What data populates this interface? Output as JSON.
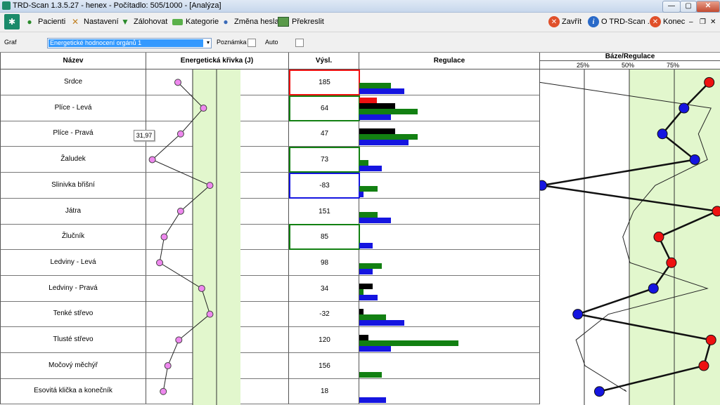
{
  "window": {
    "title": "TRD-Scan 1.3.5.27  -  henex  -  Počítadlo: 505/1000  -  [Analýza]",
    "minimize": "—",
    "maximize": "▢",
    "close": "✕"
  },
  "toolbar": {
    "pacienti": "Pacienti",
    "nastaveni": "Nastavení",
    "zalohovat": "Zálohovat",
    "kategorie": "Kategorie",
    "zmena_hesla": "Změna hesla",
    "prekreslit": "Překreslit",
    "zavrit": "Zavřít",
    "o_trd": "O TRD-Scan ...",
    "konec": "Konec",
    "mdi_min": "–",
    "mdi_restore": "❐",
    "mdi_close": "✕"
  },
  "options": {
    "graf_label": "Graf",
    "graf_value": "Energetické hodnocení orgánů 1",
    "poznamka_label": "Poznámka",
    "auto_label": "Auto"
  },
  "headers": {
    "nazev": "Název",
    "krivka": "Energetická křivka (J)",
    "vysl": "Výsl.",
    "regulace": "Regulace",
    "baze": "Báze/Regulace",
    "ticks": [
      "25%",
      "50%",
      "75%"
    ]
  },
  "tooltip": "31,97",
  "colors": {
    "red": "#ee1111",
    "green": "#128012",
    "blue": "#1515e0",
    "black": "#000000",
    "pink": "#ee88ee",
    "zone": "#e2f7cd"
  },
  "rows": [
    {
      "name": "Srdce",
      "result": "185",
      "border": "red",
      "curve": 0.3,
      "bars": [
        {
          "c": "green",
          "v": 45
        },
        {
          "c": "blue",
          "v": 64
        }
      ],
      "dot": 0.94,
      "dotColor": "red",
      "thin": 0.0
    },
    {
      "name": "Plíce - Levá",
      "result": "64",
      "border": "green",
      "curve": 0.58,
      "bars": [
        {
          "c": "red",
          "v": 25
        },
        {
          "c": "black",
          "v": 51
        },
        {
          "c": "green",
          "v": 83
        },
        {
          "c": "blue",
          "v": 45
        }
      ],
      "dot": 0.8,
      "dotColor": "blue",
      "thin": 0.95
    },
    {
      "name": "Plíce - Pravá",
      "result": "47",
      "border": "",
      "curve": 0.33,
      "bars": [
        {
          "c": "black",
          "v": 51
        },
        {
          "c": "green",
          "v": 83
        },
        {
          "c": "blue",
          "v": 70
        }
      ],
      "dot": 0.68,
      "dotColor": "blue",
      "thin": 0.88
    },
    {
      "name": "Žaludek",
      "result": "73",
      "border": "green",
      "curve": 0.02,
      "bars": [
        {
          "c": "green",
          "v": 13
        },
        {
          "c": "blue",
          "v": 32
        }
      ],
      "dot": 0.86,
      "dotColor": "blue",
      "thin": 0.93
    },
    {
      "name": "Slinivka břišní",
      "result": "-83",
      "border": "blue",
      "curve": 0.65,
      "bars": [
        {
          "c": "green",
          "v": 26
        },
        {
          "c": "blue",
          "v": 6
        }
      ],
      "dot": 0.01,
      "dotColor": "blue",
      "thin": 0.64
    },
    {
      "name": "Játra",
      "result": "151",
      "border": "",
      "curve": 0.33,
      "bars": [
        {
          "c": "green",
          "v": 26
        },
        {
          "c": "blue",
          "v": 45
        }
      ],
      "dot": 1.0,
      "dotColor": "red",
      "thin": 0.52
    },
    {
      "name": "Žlučník",
      "result": "85",
      "border": "green",
      "curve": 0.15,
      "bars": [
        {
          "c": "blue",
          "v": 19
        }
      ],
      "dot": 0.66,
      "dotColor": "red",
      "thin": 0.46
    },
    {
      "name": "Ledviny - Levá",
      "result": "98",
      "border": "",
      "curve": 0.1,
      "bars": [
        {
          "c": "green",
          "v": 32
        },
        {
          "c": "blue",
          "v": 19
        }
      ],
      "dot": 0.73,
      "dotColor": "red",
      "thin": 0.5
    },
    {
      "name": "Ledviny - Pravá",
      "result": "34",
      "border": "",
      "curve": 0.56,
      "bars": [
        {
          "c": "black",
          "v": 19
        },
        {
          "c": "green",
          "v": 6
        },
        {
          "c": "blue",
          "v": 26
        }
      ],
      "dot": 0.63,
      "dotColor": "blue",
      "thin": 0.93
    },
    {
      "name": "Tenké střevo",
      "result": "-32",
      "border": "",
      "curve": 0.65,
      "bars": [
        {
          "c": "black",
          "v": 6
        },
        {
          "c": "green",
          "v": 38
        },
        {
          "c": "blue",
          "v": 64
        }
      ],
      "dot": 0.21,
      "dotColor": "blue",
      "thin": 0.38
    },
    {
      "name": "Tlusté střevo",
      "result": "120",
      "border": "",
      "curve": 0.31,
      "bars": [
        {
          "c": "black",
          "v": 13
        },
        {
          "c": "green",
          "v": 141
        },
        {
          "c": "blue",
          "v": 45
        }
      ],
      "dot": 0.95,
      "dotColor": "red",
      "thin": 0.2
    },
    {
      "name": "Močový měchýř",
      "result": "156",
      "border": "",
      "curve": 0.19,
      "bars": [
        {
          "c": "green",
          "v": 32
        }
      ],
      "dot": 0.91,
      "dotColor": "red",
      "thin": 0.25
    },
    {
      "name": "Esovitá klička a konečník",
      "result": "18",
      "border": "",
      "curve": 0.14,
      "bars": [
        {
          "c": "blue",
          "v": 38
        }
      ],
      "dot": 0.33,
      "dotColor": "blue",
      "thin": 0.48
    }
  ]
}
